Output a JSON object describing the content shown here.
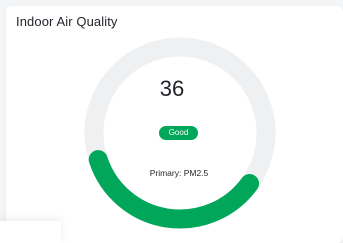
{
  "card": {
    "title": "Indoor Air Quality"
  },
  "aqi": {
    "value": "36",
    "status": "Good",
    "primary_pollutant_text": "Primary: PM2.5",
    "scale_fraction": 0.35
  },
  "colors": {
    "good": "#00a65a",
    "track": "#eef0f2",
    "text": "#1f2328"
  }
}
